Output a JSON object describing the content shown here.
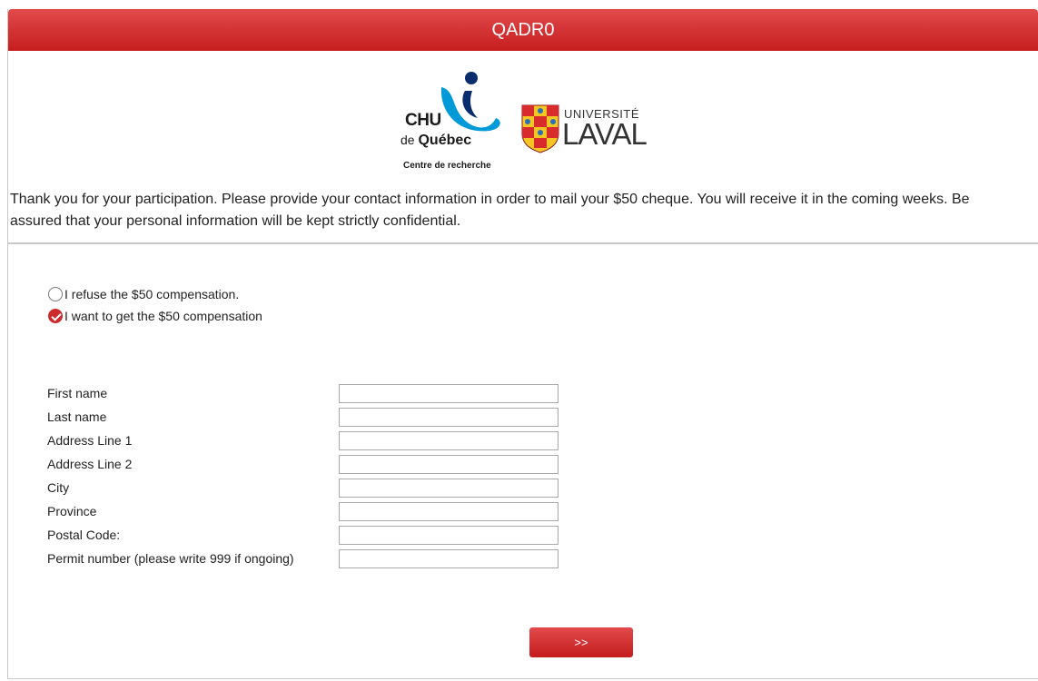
{
  "header": {
    "title": "QADR0"
  },
  "logos": {
    "chu": {
      "line1": "CHU",
      "line2_prefix": "de ",
      "line2_bold": "Québec",
      "line3": "Centre de recherche",
      "accent": "#009ad8",
      "dot": "#0a2d6e"
    },
    "laval": {
      "line1": "UNIVERSITÉ",
      "line2": "LAVAL",
      "shield_red": "#d82b2b",
      "shield_yellow": "#f3c623"
    }
  },
  "intro": {
    "text": "Thank you for your participation. Please provide your contact information in order to mail your $50 cheque. You will receive it in the coming weeks. Be assured that your personal information will be kept strictly confidential."
  },
  "compensation": {
    "options": [
      {
        "label": "I refuse the $50 compensation.",
        "checked": false
      },
      {
        "label": "I want to get the $50 compensation",
        "checked": true
      }
    ]
  },
  "form": {
    "fields": [
      {
        "label": "First name",
        "value": ""
      },
      {
        "label": "Last name",
        "value": ""
      },
      {
        "label": "Address Line 1",
        "value": ""
      },
      {
        "label": "Address Line 2",
        "value": ""
      },
      {
        "label": "City",
        "value": ""
      },
      {
        "label": "Province",
        "value": ""
      },
      {
        "label": "Postal Code:",
        "value": ""
      },
      {
        "label": "Permit number (please write 999 if ongoing)",
        "value": ""
      }
    ]
  },
  "nav": {
    "next_label": ">>"
  },
  "colors": {
    "accent": "#cc2a2b",
    "header_top": "#e24a4b",
    "header_bottom": "#c61e1f"
  }
}
